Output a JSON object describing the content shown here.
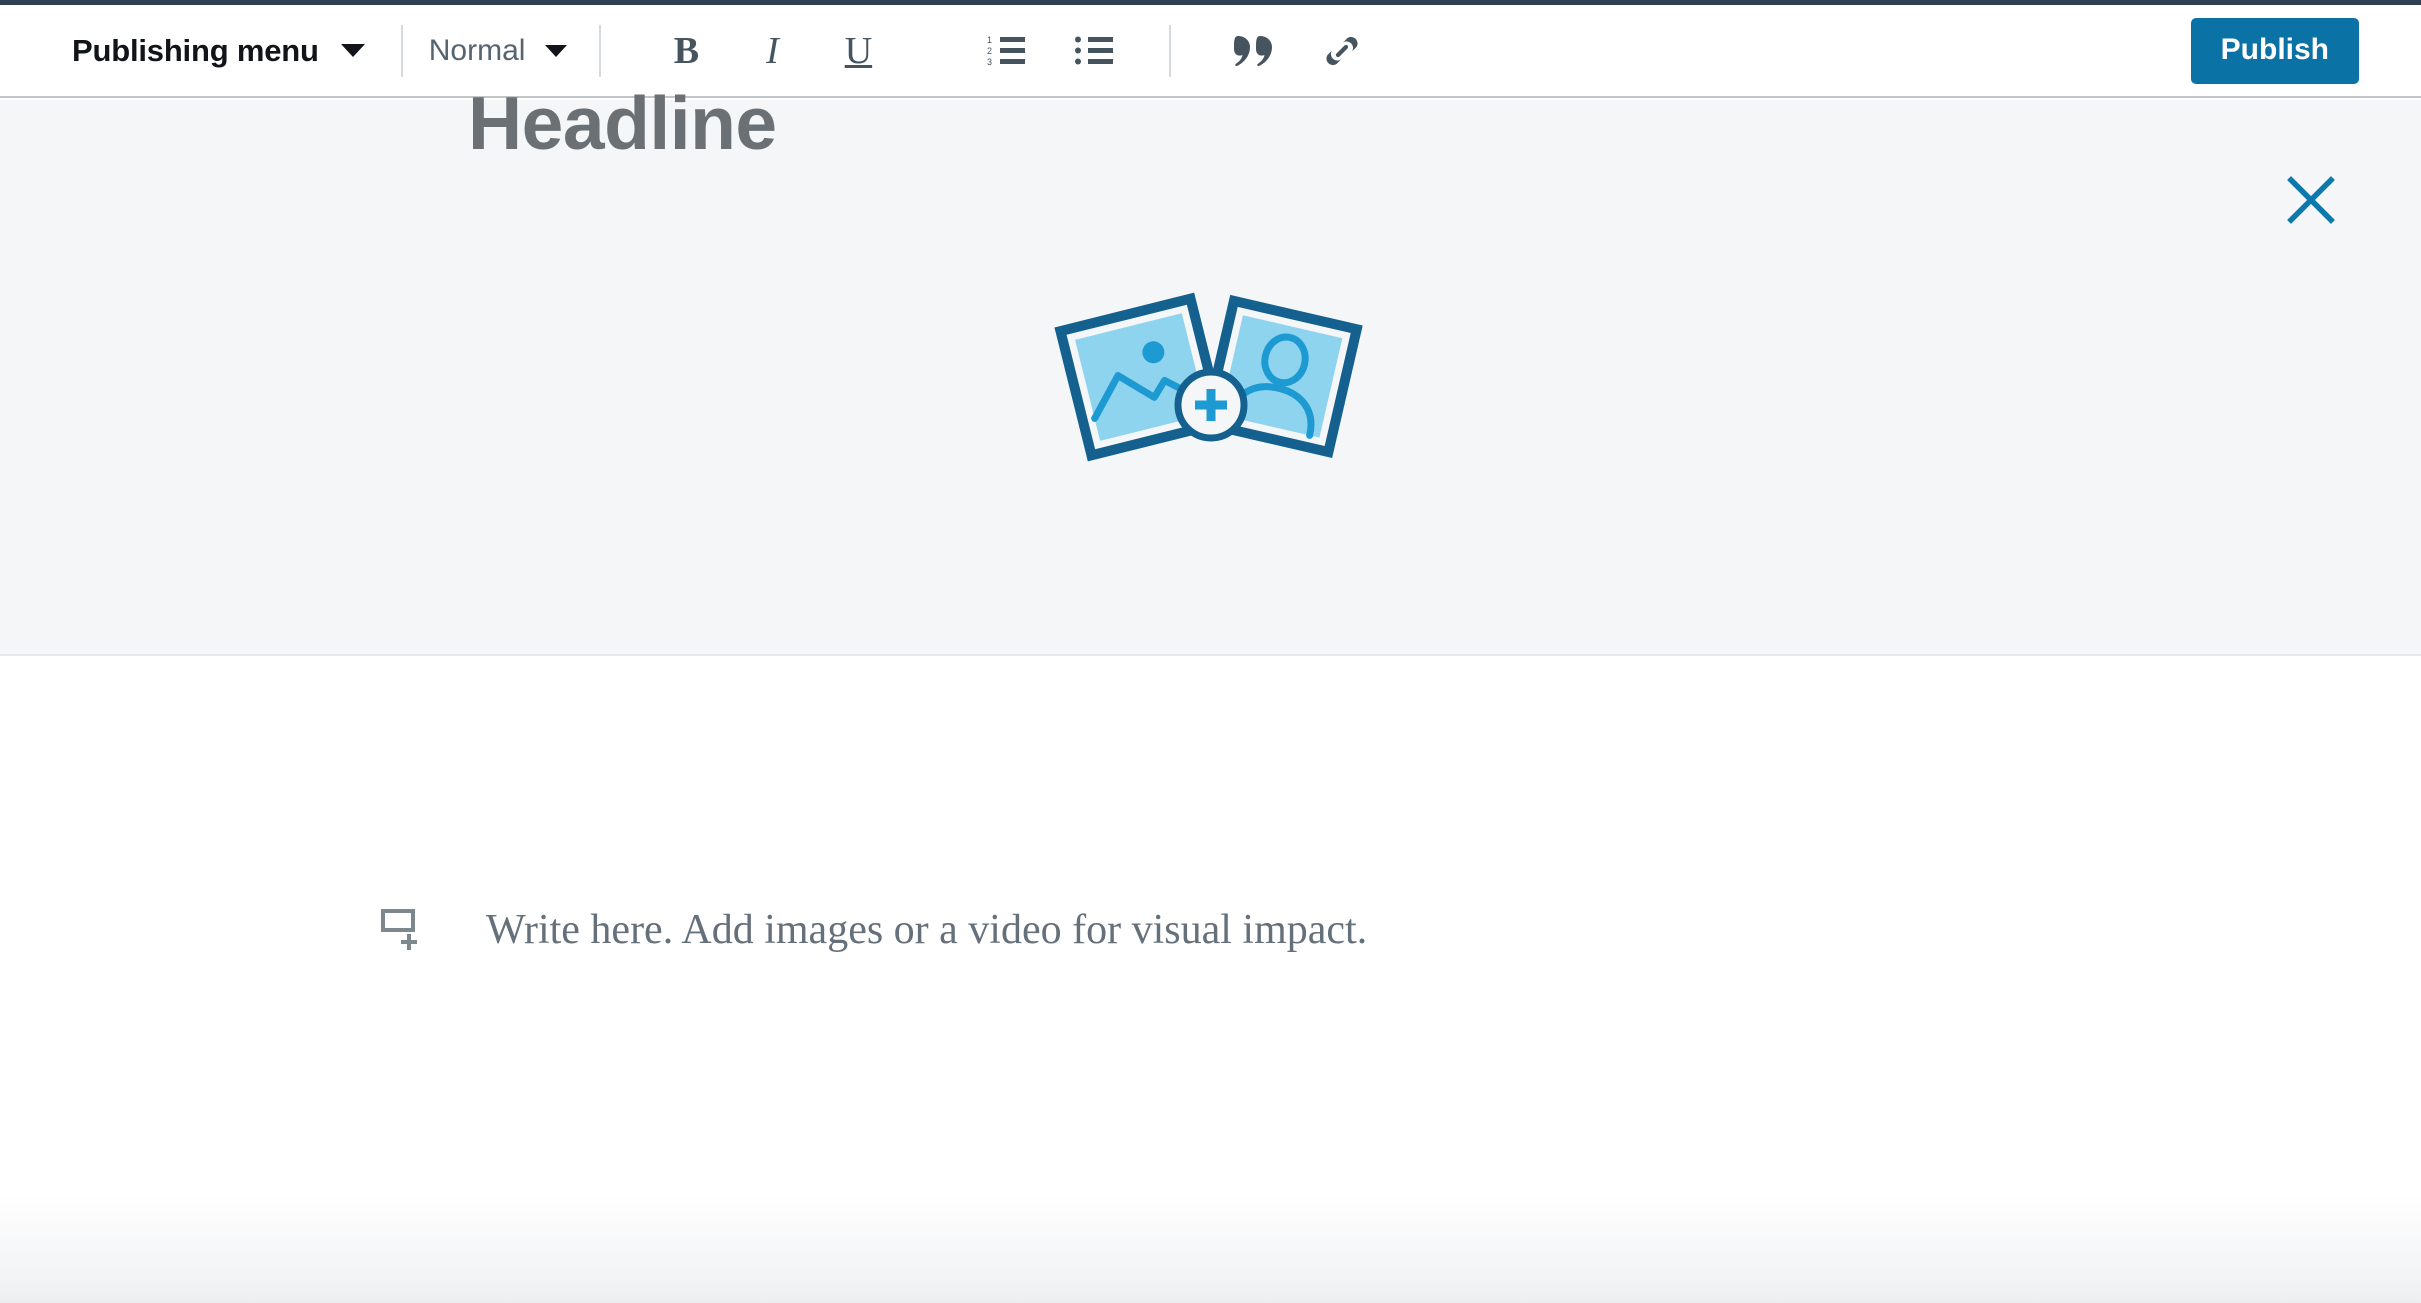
{
  "window": {
    "top_strip_color": "#2e4052"
  },
  "toolbar": {
    "publishing_menu_label": "Publishing menu",
    "style_select_value": "Normal",
    "style_options": [
      "Normal"
    ],
    "format_buttons": [
      {
        "name": "bold",
        "glyph": "B"
      },
      {
        "name": "italic",
        "glyph": "I"
      },
      {
        "name": "underline",
        "glyph": "U"
      }
    ],
    "list_buttons": [
      {
        "name": "ordered-list"
      },
      {
        "name": "unordered-list"
      }
    ],
    "insert_buttons": [
      {
        "name": "blockquote"
      },
      {
        "name": "link"
      }
    ],
    "publish_label": "Publish",
    "publish_color": "#0b72a5",
    "divider_color": "#d5dade"
  },
  "hero": {
    "background_color": "#f4f6f8",
    "close_icon": "close-icon",
    "close_icon_color": "#0b79ae",
    "art_icon": "add-cover-images-icon",
    "art_outline_color": "#14618f",
    "art_fill_color": "#8ed4ef",
    "art_accent_color": "#1e9ad2"
  },
  "article": {
    "headline_placeholder": "Headline",
    "headline_color": "#6a7074",
    "body_icon": "add-media-icon",
    "body_placeholder": "Write here. Add images or a video for visual impact.",
    "body_color": "#65707a"
  }
}
